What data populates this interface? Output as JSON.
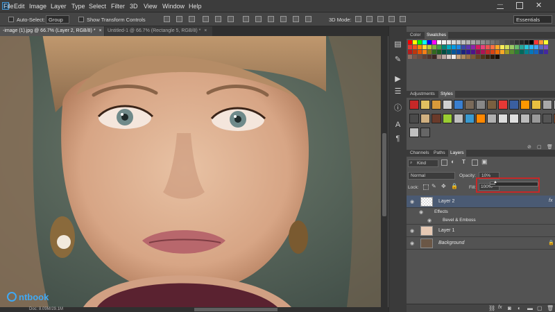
{
  "menu": {
    "items": [
      "File",
      "Edit",
      "Image",
      "Layer",
      "Type",
      "Select",
      "Filter",
      "3D",
      "View",
      "Window",
      "Help"
    ],
    "workspace": "Essentials"
  },
  "options": {
    "auto_select_label": "Auto-Select:",
    "auto_select_value": "Group",
    "show_transform_label": "Show Transform Controls",
    "mode_3d_label": "3D Mode:"
  },
  "tabs": [
    {
      "label": "-image (1).jpg @ 66.7% (Layer 2, RGB/8) *",
      "close": "×",
      "active": true
    },
    {
      "label": "Untitled-1 @ 66.7% (Rectangle 5, RGB/8) *",
      "close": "×",
      "active": false
    }
  ],
  "status": {
    "doc": "Doc: 8.09M/29.1M"
  },
  "watermark": "ntbook",
  "panels": {
    "color_tab": "Color",
    "swatches_tab": "Swatches",
    "adjustments_tab": "Adjustments",
    "styles_tab": "Styles",
    "channels_tab": "Channels",
    "paths_tab": "Paths",
    "layers_tab": "Layers"
  },
  "layers_panel": {
    "filter_kind": "Kind",
    "blend_mode": "Normal",
    "opacity_label": "Opacity:",
    "opacity_value": "10%",
    "lock_label": "Lock:",
    "fill_label": "Fill:",
    "fill_value": "100%",
    "fill_slider_level": 0.1,
    "layers": [
      {
        "name": "Layer 2",
        "selected": true,
        "effects": [
          "Effects",
          "Bevel & Emboss"
        ]
      },
      {
        "name": "Layer 1",
        "selected": false
      },
      {
        "name": "Background",
        "selected": false
      }
    ]
  },
  "colors": {
    "accent_highlight": "#c62828",
    "selected_layer": "#4a5a73",
    "ui_dark": "#3c3c3c",
    "panel": "#535353"
  },
  "icons": [
    "move-icon",
    "align-icons",
    "distribute-icons",
    "3d-mode-icons",
    "eye-icon",
    "lock-icon",
    "fx-icon",
    "link-icon",
    "trash-icon",
    "new-layer-icon",
    "folder-icon",
    "mask-icon",
    "adjustment-icon"
  ]
}
